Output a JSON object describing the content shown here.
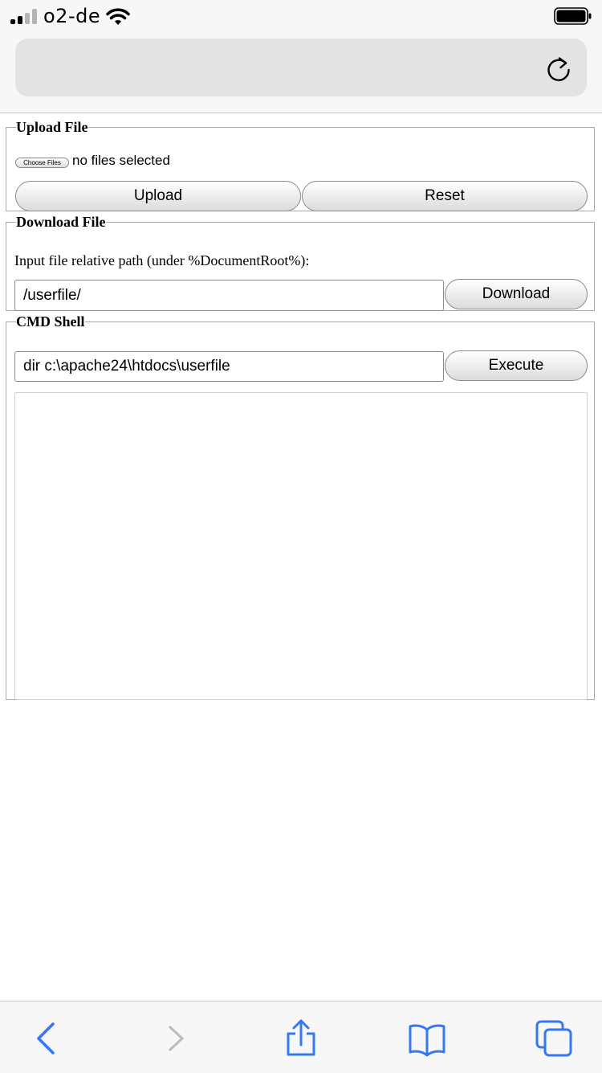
{
  "status_bar": {
    "carrier": "o2-de",
    "signal_bars_active": 2,
    "signal_bars_total": 4
  },
  "address_bar": {
    "url": "",
    "reload_icon": "reload-icon"
  },
  "upload": {
    "legend": "Upload File",
    "choose_label": "Choose Files",
    "file_status": "no files selected",
    "upload_label": "Upload",
    "reset_label": "Reset"
  },
  "download": {
    "legend": "Download File",
    "instruction": "Input file relative path (under %DocumentRoot%):",
    "path_value": "/userfile/",
    "download_label": "Download"
  },
  "cmd": {
    "legend": "CMD Shell",
    "command_value": "dir c:\\apache24\\htdocs\\userfile",
    "execute_label": "Execute",
    "output": ""
  },
  "toolbar": {
    "icons": [
      "back-icon",
      "forward-icon",
      "share-icon",
      "bookmarks-icon",
      "tabs-icon"
    ],
    "accent_color": "#3478f6",
    "disabled_color": "#bcbcbc"
  }
}
